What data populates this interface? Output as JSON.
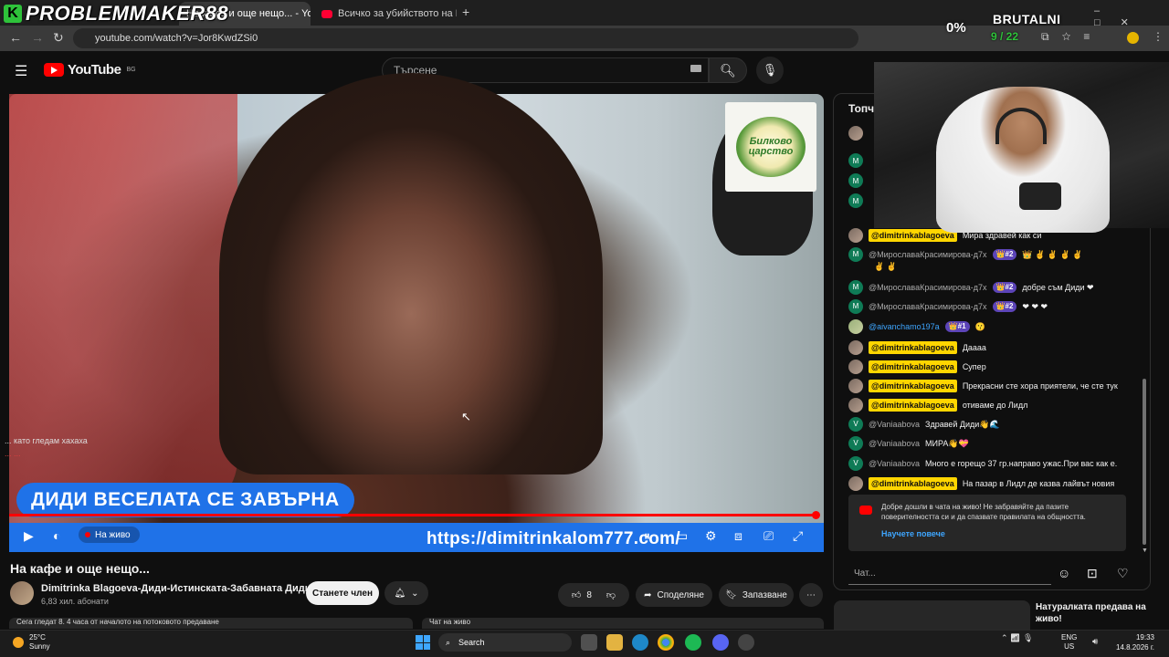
{
  "overlay": {
    "brand": "PROBLEMMAKER88",
    "brutal": "BRUTALNI",
    "percent": "0%",
    "counter": "9 / 22"
  },
  "browser": {
    "tabs": [
      {
        "title": "На кафе и още нещо... - YouTube",
        "active": true
      },
      {
        "title": "Всичко за убийството на Георг",
        "active": false
      }
    ],
    "new_tab": "+",
    "url": "youtube.com/watch?v=Jor8KwdZSi0"
  },
  "youtube": {
    "logo_text": "YouTube",
    "region": "BG",
    "search_placeholder": "Търсене"
  },
  "video": {
    "sponsor_name": "Билково царство",
    "banner": "ДИДИ ВЕСЕЛАТА СЕ ЗАВЪРНА",
    "live_label": "На живо",
    "overlay_url": "https://dimitrinkalom777.com/",
    "progress_fraction": 1.0,
    "overlay_chat": [
      "... като гледам хахаха",
      "... ..."
    ]
  },
  "meta": {
    "title": "На кафе и още нещо...",
    "channel_name": "Dimitrinka Blagoeva-Диди-Истинската-Забавната Диди",
    "subscribers": "6,83 хил. абонати",
    "join_label": "Станете член",
    "likes": "8",
    "share_label": "Споделяне",
    "save_label": "Запазване",
    "description_preview": "Сега гледат 8. 4 часа от началото на потоковото предаване",
    "chat_preview": "Чат на живо"
  },
  "chat": {
    "title": "Топча",
    "messages": [
      {
        "author": "@dimitrinkablagoeva",
        "owner": true,
        "text": "Мира здравей как си",
        "avatar": "p",
        "initial": ""
      },
      {
        "author": "@МирославаКрасимирова-д7х",
        "rank": "#2",
        "text": "👑 ✌ ✌ ✌ ✌",
        "text2": "✌ ✌",
        "avatar": "m",
        "initial": "M"
      },
      {
        "author": "@МирославаКрасимирова-д7х",
        "rank": "#2",
        "text": "добре съм Диди ❤",
        "avatar": "m",
        "initial": "M"
      },
      {
        "author": "@МирославаКрасимирова-д7х",
        "rank": "#2",
        "text": "❤ ❤ ❤",
        "avatar": "m",
        "initial": "M"
      },
      {
        "author": "@aivanchamo197a",
        "rank": "#1",
        "text": "😗",
        "avatar": "g",
        "initial": "",
        "blue": true
      },
      {
        "author": "@dimitrinkablagoeva",
        "owner": true,
        "text": "Даааа",
        "avatar": "p",
        "initial": ""
      },
      {
        "author": "@dimitrinkablagoeva",
        "owner": true,
        "text": "Супер",
        "avatar": "p",
        "initial": ""
      },
      {
        "author": "@dimitrinkablagoeva",
        "owner": true,
        "text": "Прекрасни сте хора приятели, че сте тук",
        "avatar": "p",
        "initial": ""
      },
      {
        "author": "@dimitrinkablagoeva",
        "owner": true,
        "text": "отиваме до Лидл",
        "avatar": "p",
        "initial": ""
      },
      {
        "author": "@Vaniaabova",
        "text": "Здравей Диди👋🌊",
        "avatar": "v",
        "initial": "V"
      },
      {
        "author": "@Vaniaabova",
        "text": "МИРА👋💝",
        "avatar": "v",
        "initial": "V"
      },
      {
        "author": "@Vaniaabova",
        "text": "Много е горещо 37 гр.направо ужас.При вас как е.",
        "avatar": "v",
        "initial": "V"
      },
      {
        "author": "@dimitrinkablagoeva",
        "owner": true,
        "text": "На пазар в Лидл де казва лайвът новия",
        "avatar": "p",
        "initial": ""
      }
    ],
    "welcome_text": "Добре дошли в чата на живо! Не забравяйте да пазите поверителността си и да спазвате правилата на общността.",
    "learn_more": "Научете повече",
    "input_placeholder": "Чат..."
  },
  "recommendation": {
    "title": "Натуралката предава на живо!"
  },
  "taskbar": {
    "temp": "25°C",
    "weather": "Sunny",
    "search": "Search",
    "lang1": "ENG",
    "lang2": "US",
    "time": "19:33",
    "date": "14.8.2026 г."
  },
  "colors": {
    "accent_blue": "#1f72e8",
    "youtube_red": "#ff0000",
    "owner_badge": "#ffd600",
    "bg": "#0f0f0f"
  }
}
